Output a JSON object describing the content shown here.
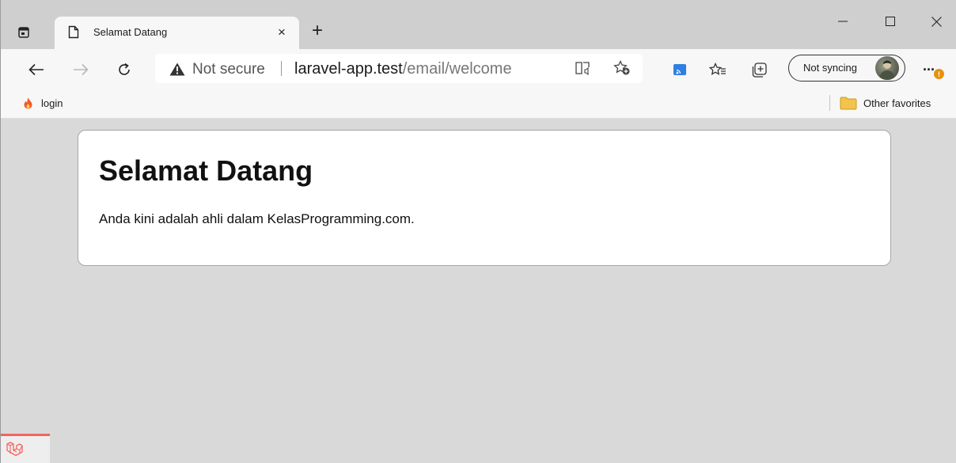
{
  "tab": {
    "title": "Selamat Datang",
    "close_glyph": "×",
    "new_tab_glyph": "+"
  },
  "window_controls": {
    "minimize_glyph": "—",
    "close_glyph": "✕"
  },
  "toolbar": {
    "security_text": "Not secure",
    "url_host": "laravel-app.test",
    "url_path": "/email/welcome",
    "sync_label": "Not syncing",
    "more_glyph": "···",
    "notification_badge": "!"
  },
  "favorites": {
    "items": [
      {
        "label": "login",
        "icon": "flame-icon"
      }
    ],
    "other_label": "Other favorites"
  },
  "page": {
    "heading": "Selamat Datang",
    "message": "Anda kini adalah ahli dalam KelasProgramming.com."
  },
  "colors": {
    "accent_debugbar": "#f4645f",
    "favicon_flame": "#f05a28",
    "folder": "#f3c44b",
    "badge": "#e8910c",
    "cast_icon": "#2f7fe3"
  }
}
